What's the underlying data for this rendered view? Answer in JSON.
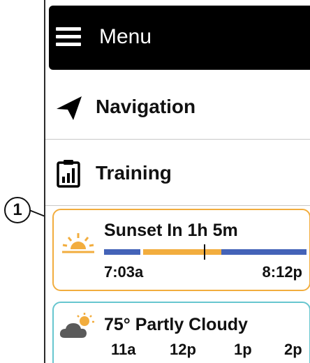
{
  "callout": {
    "number": "1"
  },
  "menu": {
    "label": "Menu",
    "icon": "hamburger-icon"
  },
  "items": [
    {
      "label": "Navigation",
      "icon": "navigation-arrow-icon"
    },
    {
      "label": "Training",
      "icon": "training-icon"
    }
  ],
  "sunset": {
    "title": "Sunset In 1h 5m",
    "start": "7:03a",
    "end": "8:12p",
    "icon": "sunset-icon"
  },
  "weather": {
    "title": "75° Partly Cloudy",
    "icon": "partly-cloudy-icon",
    "hours": [
      "11a",
      "12p",
      "1p",
      "2p"
    ]
  },
  "colors": {
    "accent_orange": "#f2ad3e",
    "accent_blue": "#4463b8",
    "accent_teal": "#67c6cf"
  }
}
